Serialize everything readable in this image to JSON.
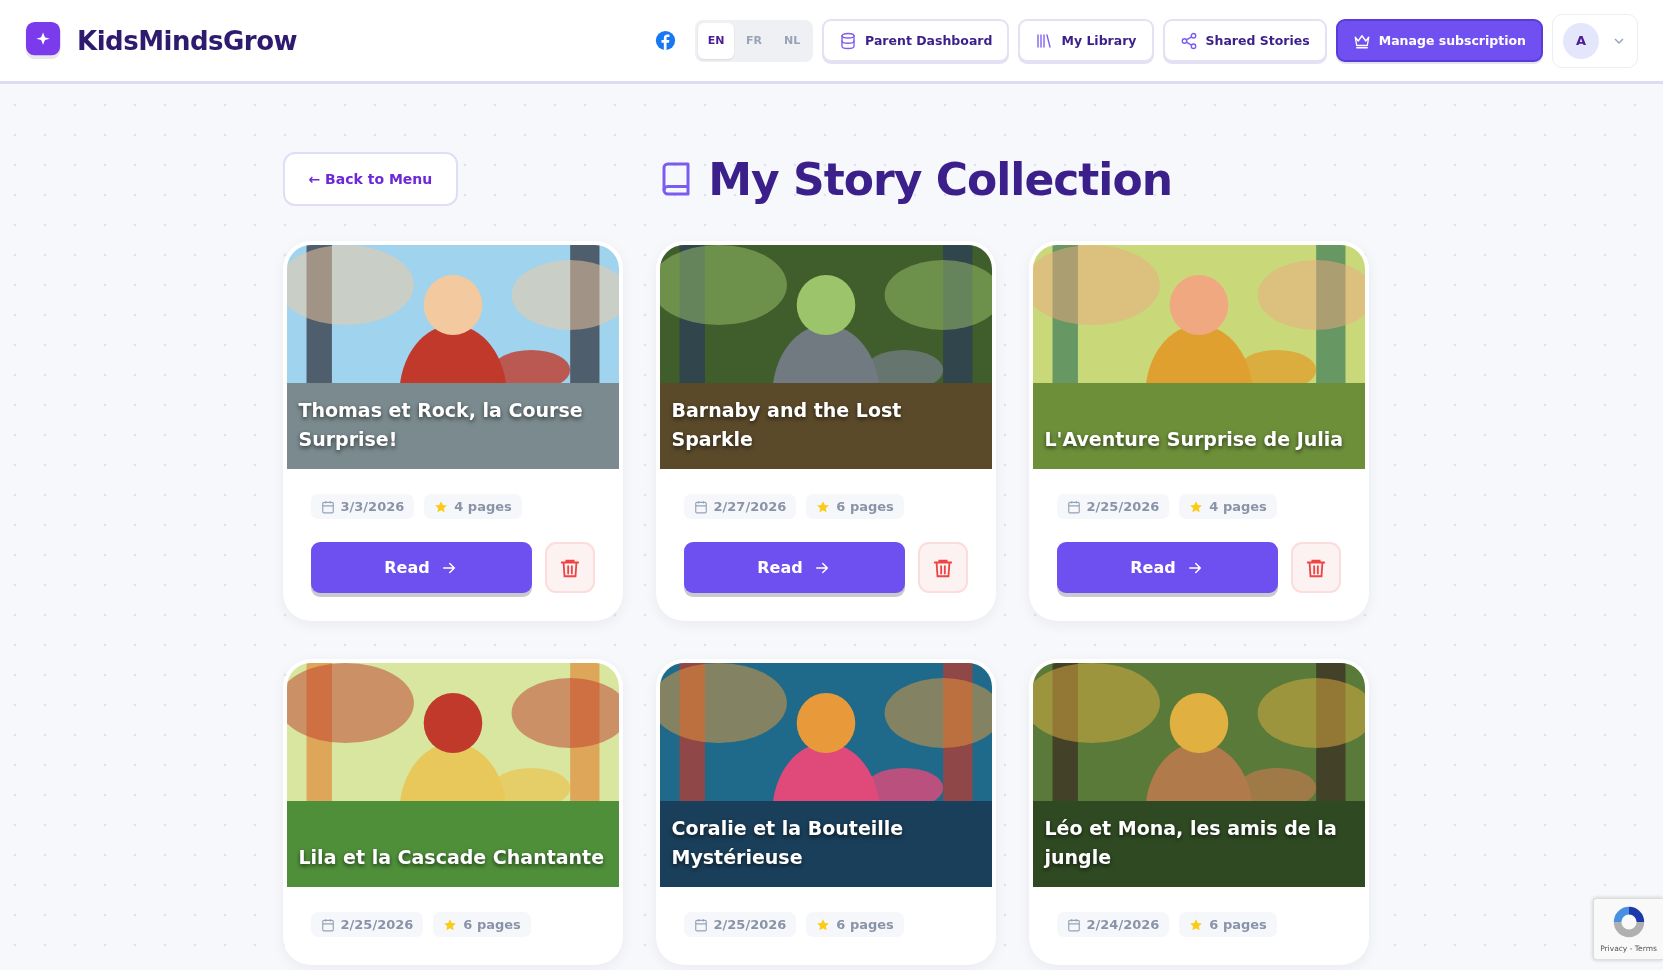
{
  "brand": {
    "name": "KidsMindsGrow"
  },
  "languages": [
    {
      "label": "EN",
      "selected": true
    },
    {
      "label": "FR",
      "selected": false
    },
    {
      "label": "NL",
      "selected": false
    }
  ],
  "nav": [
    {
      "label": "Parent Dashboard",
      "kind": "database",
      "primary": false
    },
    {
      "label": "My Library",
      "kind": "library",
      "primary": false
    },
    {
      "label": "Shared Stories",
      "kind": "share",
      "primary": false
    },
    {
      "label": "Manage subscription",
      "kind": "crown",
      "primary": true
    }
  ],
  "user": {
    "initial": "A"
  },
  "back_button": "← Back to Menu",
  "page_title": "My Story Collection",
  "stories": [
    {
      "title": "Thomas et Rock, la Course Surprise!",
      "date": "3/3/2026",
      "pages": "4 pages",
      "read_label": "Read"
    },
    {
      "title": "Barnaby and the Lost Sparkle",
      "date": "2/27/2026",
      "pages": "6 pages",
      "read_label": "Read"
    },
    {
      "title": "L'Aventure Surprise de Julia",
      "date": "2/25/2026",
      "pages": "4 pages",
      "read_label": "Read"
    },
    {
      "title": "Lila et la Cascade Chantante",
      "date": "2/25/2026",
      "pages": "6 pages"
    },
    {
      "title": "Coralie et la Bouteille Mystérieuse",
      "date": "2/25/2026",
      "pages": "6 pages"
    },
    {
      "title": "Léo et Mona, les amis de la jungle",
      "date": "2/24/2026",
      "pages": "6 pages"
    }
  ],
  "recaptcha": {
    "links": "Privacy - Terms"
  }
}
